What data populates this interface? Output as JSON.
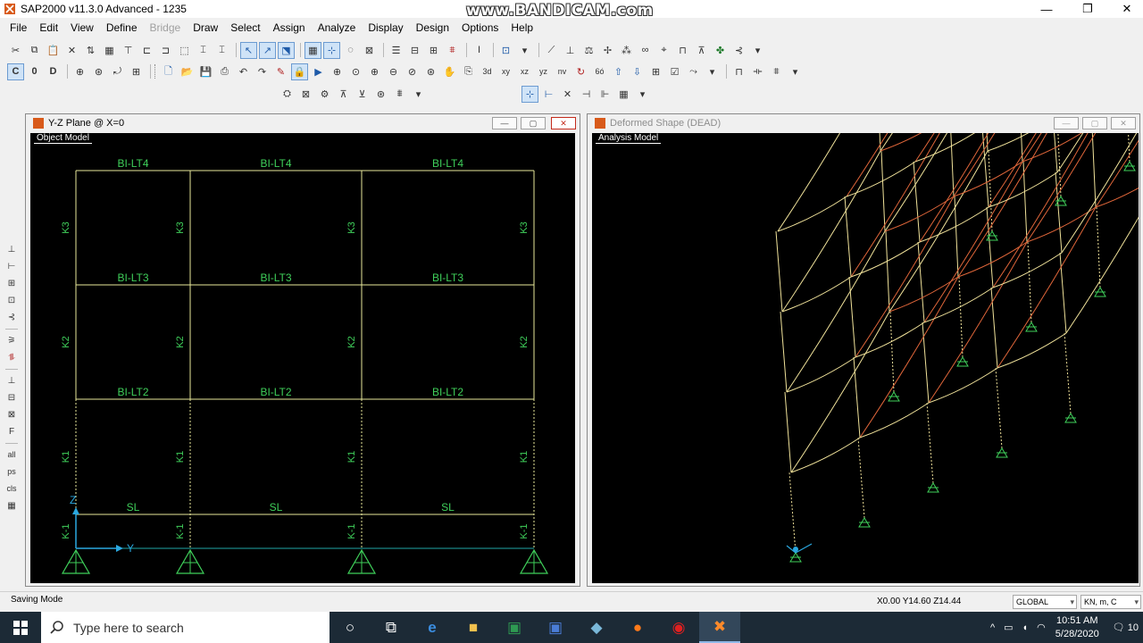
{
  "window": {
    "title": "SAP2000 v11.3.0 Advanced - 1235"
  },
  "watermark": "www.BANDICAM.com",
  "menu": [
    {
      "label": "File",
      "disabled": false
    },
    {
      "label": "Edit",
      "disabled": false
    },
    {
      "label": "View",
      "disabled": false
    },
    {
      "label": "Define",
      "disabled": false
    },
    {
      "label": "Bridge",
      "disabled": true
    },
    {
      "label": "Draw",
      "disabled": false
    },
    {
      "label": "Select",
      "disabled": false
    },
    {
      "label": "Assign",
      "disabled": false
    },
    {
      "label": "Analyze",
      "disabled": false
    },
    {
      "label": "Display",
      "disabled": false
    },
    {
      "label": "Design",
      "disabled": false
    },
    {
      "label": "Options",
      "disabled": false
    },
    {
      "label": "Help",
      "disabled": false
    }
  ],
  "left_window": {
    "title": "Y-Z Plane @ X=0",
    "tag": "Object Model",
    "beam_labels": [
      "BI-LT4",
      "BI-LT4",
      "BI-LT4",
      "BI-LT3",
      "BI-LT3",
      "BI-LT3",
      "BI-LT2",
      "BI-LT2",
      "BI-LT2",
      "SL",
      "SL",
      "SL"
    ],
    "column_labels": [
      "K3",
      "K2",
      "K1",
      "K-1"
    ],
    "axis_y": "Y",
    "axis_z": "Z"
  },
  "right_window": {
    "title": "Deformed Shape (DEAD)",
    "tag": "Analysis Model"
  },
  "status": {
    "text": "Saving Mode",
    "coords": "X0.00  Y14.60  Z14.44",
    "coord_system": "GLOBAL",
    "units": "KN, m, C"
  },
  "taskbar": {
    "search_placeholder": "Type here to search",
    "time": "10:51 AM",
    "date": "5/28/2020",
    "notifications": "10"
  },
  "colors": {
    "frame": "#e8e89a",
    "label": "#3fcf5a",
    "restraint": "#3fcf5a",
    "deformed_beam": "#e0663a",
    "deformed_col": "#f0e29a"
  }
}
